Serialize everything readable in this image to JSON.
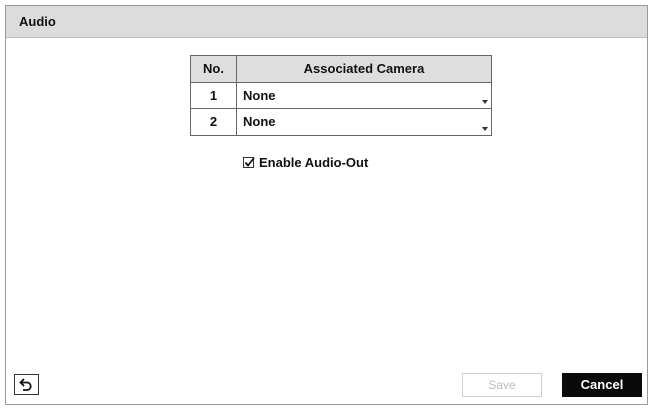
{
  "window": {
    "title": "Audio"
  },
  "camera_table": {
    "headers": {
      "no": "No.",
      "camera": "Associated Camera"
    },
    "rows": [
      {
        "no": "1",
        "camera": "None"
      },
      {
        "no": "2",
        "camera": "None"
      }
    ]
  },
  "enable_audio_out": {
    "label": "Enable Audio-Out",
    "checked": true
  },
  "footer": {
    "back_icon": "back-arrow-icon",
    "save_label": "Save",
    "save_enabled": false,
    "cancel_label": "Cancel"
  },
  "colors": {
    "titlebar": "#dcdcdc",
    "cancel_bg": "#0a0a0a",
    "disabled_text": "#bdbdbd"
  }
}
